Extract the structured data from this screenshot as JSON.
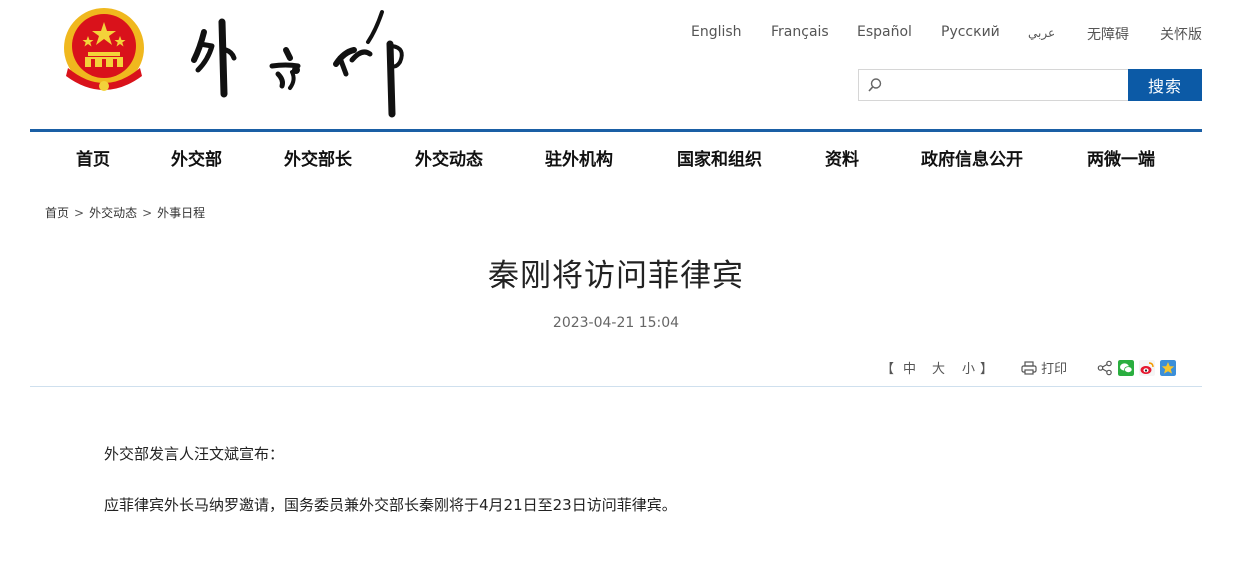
{
  "header": {
    "site_name": "外交部",
    "languages": [
      "English",
      "Français",
      "Español",
      "Русский",
      "عربي",
      "无障碍",
      "关怀版"
    ],
    "search": {
      "placeholder": "",
      "button_label": "搜索"
    }
  },
  "nav": {
    "items": [
      "首页",
      "外交部",
      "外交部长",
      "外交动态",
      "驻外机构",
      "国家和组织",
      "资料",
      "政府信息公开",
      "两微一端"
    ]
  },
  "breadcrumb": [
    "首页",
    "外交动态",
    "外事日程"
  ],
  "breadcrumb_separator": ">",
  "article": {
    "title": "秦刚将访问菲律宾",
    "date": "2023-04-21 15:04",
    "paragraphs": [
      "外交部发言人汪文斌宣布：",
      "应菲律宾外长马纳罗邀请，国务委员兼外交部长秦刚将于4月21日至23日访问菲律宾。"
    ]
  },
  "tools": {
    "font_size": {
      "open": "【",
      "large": "中",
      "medium": "大",
      "small": "小",
      "close": "】"
    },
    "print_label": "打印"
  },
  "colors": {
    "accent": "#0c5aa6",
    "nav_line": "#1a5fa5",
    "emblem_red": "#d9121b",
    "emblem_gold": "#f3c21f"
  }
}
